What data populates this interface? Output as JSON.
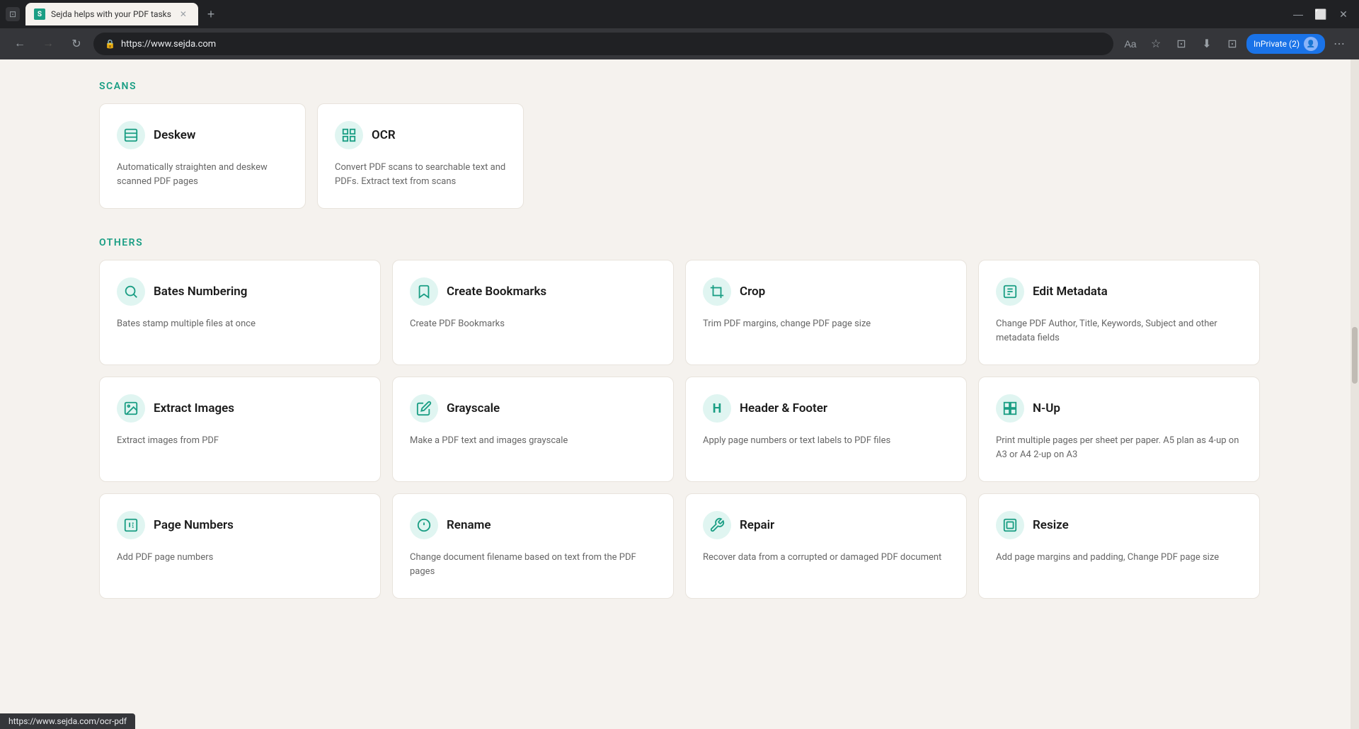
{
  "browser": {
    "tab_title": "Sejda helps with your PDF tasks",
    "tab_favicon": "S",
    "address": "https://www.sejda.com",
    "inprivate_label": "InPrivate (2)"
  },
  "sections": [
    {
      "id": "scans",
      "title": "SCANS",
      "layout": "2col",
      "cards": [
        {
          "id": "deskew",
          "title": "Deskew",
          "desc": "Automatically straighten and deskew scanned PDF pages",
          "icon": "📄"
        },
        {
          "id": "ocr",
          "title": "OCR",
          "desc": "Convert PDF scans to searchable text and PDFs. Extract text from scans",
          "icon": "⊞"
        }
      ]
    },
    {
      "id": "others",
      "title": "OTHERS",
      "layout": "4col",
      "rows": [
        [
          {
            "id": "bates-numbering",
            "title": "Bates Numbering",
            "desc": "Bates stamp multiple files at once",
            "icon": "🔍"
          },
          {
            "id": "create-bookmarks",
            "title": "Create Bookmarks",
            "desc": "Create PDF Bookmarks",
            "icon": "🔖"
          },
          {
            "id": "crop",
            "title": "Crop",
            "desc": "Trim PDF margins, change PDF page size",
            "icon": "✂"
          },
          {
            "id": "edit-metadata",
            "title": "Edit Metadata",
            "desc": "Change PDF Author, Title, Keywords, Subject and other metadata fields",
            "icon": "⊟"
          }
        ],
        [
          {
            "id": "extract-images",
            "title": "Extract Images",
            "desc": "Extract images from PDF",
            "icon": "🖼"
          },
          {
            "id": "grayscale",
            "title": "Grayscale",
            "desc": "Make a PDF text and images grayscale",
            "icon": "✏"
          },
          {
            "id": "header-footer",
            "title": "Header & Footer",
            "desc": "Apply page numbers or text labels to PDF files",
            "icon": "H"
          },
          {
            "id": "n-up",
            "title": "N-Up",
            "desc": "Print multiple pages per sheet per paper. A5 plan as 4-up on A3 or A4 2-up on A3",
            "icon": "⊞"
          }
        ],
        [
          {
            "id": "page-numbers",
            "title": "Page Numbers",
            "desc": "Add PDF page numbers",
            "icon": "①"
          },
          {
            "id": "rename",
            "title": "Rename",
            "desc": "Change document filename based on text from the PDF pages",
            "icon": "ℹ"
          },
          {
            "id": "repair",
            "title": "Repair",
            "desc": "Recover data from a corrupted or damaged PDF document",
            "icon": "🔧"
          },
          {
            "id": "resize",
            "title": "Resize",
            "desc": "Add page margins and padding, Change PDF page size",
            "icon": "⊞"
          }
        ]
      ]
    }
  ],
  "status_bar": {
    "url": "https://www.sejda.com/ocr-pdf"
  },
  "icons": {
    "deskew": "≡",
    "ocr": "⊞",
    "bates": "⚲",
    "bookmarks": "◫",
    "crop": "✦",
    "edit_metadata": "⊟",
    "extract": "◱",
    "grayscale": "✎",
    "header_footer": "H",
    "nup": "⊞",
    "page_numbers": "①",
    "rename": "ⓘ",
    "repair": "⚙",
    "resize": "⊡"
  }
}
